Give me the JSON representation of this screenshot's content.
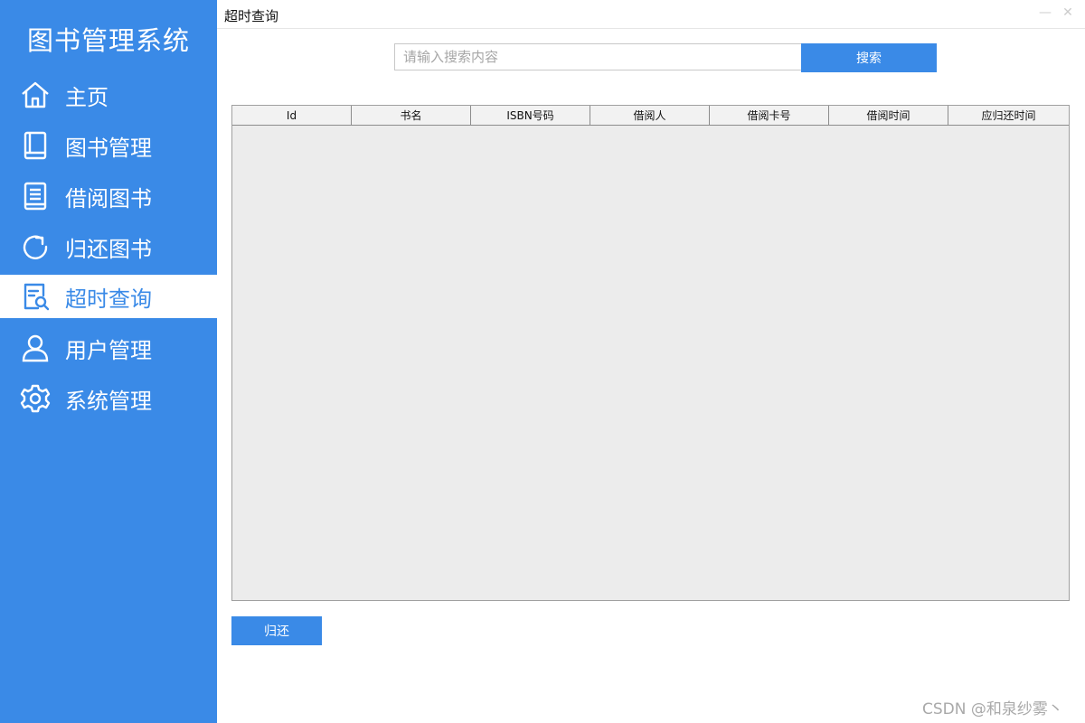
{
  "sidebar": {
    "title": "图书管理系统",
    "items": [
      {
        "label": "主页",
        "icon": "home-icon"
      },
      {
        "label": "图书管理",
        "icon": "book-icon"
      },
      {
        "label": "借阅图书",
        "icon": "book-lines-icon"
      },
      {
        "label": "归还图书",
        "icon": "return-arrow-icon"
      },
      {
        "label": "超时查询",
        "icon": "search-doc-icon",
        "active": true
      },
      {
        "label": "用户管理",
        "icon": "user-icon"
      },
      {
        "label": "系统管理",
        "icon": "gear-icon"
      }
    ]
  },
  "window": {
    "title": "超时查询",
    "minimize_glyph": "—",
    "close_glyph": "✕"
  },
  "search": {
    "placeholder": "请输入搜索内容",
    "value": "",
    "button_label": "搜索"
  },
  "table": {
    "columns": [
      "Id",
      "书名",
      "ISBN号码",
      "借阅人",
      "借阅卡号",
      "借阅时间",
      "应归还时间"
    ],
    "rows": []
  },
  "return_button_label": "归还",
  "watermark": "CSDN @和泉纱雾丶",
  "colors": {
    "primary": "#3a8ae7",
    "table_bg": "#ececec",
    "active_bg": "#ffffff"
  }
}
